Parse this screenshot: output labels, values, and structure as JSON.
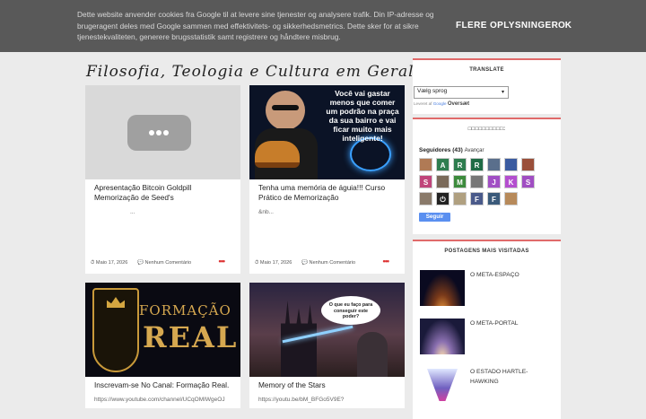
{
  "cookie": {
    "text": "Dette website anvender cookies fra Google til at levere sine tjenester og analysere trafik. Din IP-adresse og brugeragent deles med Google sammen med effektivitets- og sikkerhedsmetrics. Dette sker for at sikre tjenestekvaliteten, generere brugsstatistik samt registrere og håndtere misbrug.",
    "more_label": "FLERE OPLYSNINGER",
    "ok_label": "OK"
  },
  "blog": {
    "title": "Filosofia, Teologia e Cultura em Geral!"
  },
  "posts": [
    {
      "title": "Apresentação Bitcoin Goldpill Memorização de Seed's",
      "excerpt": "...",
      "date": "Maio 17, 2026",
      "comments": "Nenhum Comentário"
    },
    {
      "title": "Tenha uma memória de águia!!! Curso Prático de Memorização",
      "excerpt": "&nb...",
      "date": "Maio 17, 2026",
      "comments": "Nenhum Comentário",
      "thumb_text": "Você vai gastar menos que comer um podrão na praça da sua bairro e vai ficar muito mais inteligente!"
    },
    {
      "title": "Inscrevam-se No Canal: Formação Real.",
      "excerpt": "https://www.youtube.com/channel/UCqOMIWgeOJ",
      "thumb_line1": "FORMAÇÃO",
      "thumb_line2": "REAL"
    },
    {
      "title": "Memory of the Stars",
      "excerpt": "https://youtu.be/bM_BFGo5V9E?",
      "thumb_bubble": "O que eu faço para conseguir este poder?"
    }
  ],
  "more_dots": "•••",
  "sidebar": {
    "translate": {
      "title": "TRANSLATE",
      "select_value": "Vælg sprog",
      "powered_prefix": "Leveret af",
      "powered_google": "Google",
      "powered_suffix": "Oversæt"
    },
    "followers": {
      "title": "□□□□□□□□□□:",
      "label": "Seguidores (43)",
      "advance": "Avançar",
      "follow_label": "Seguir",
      "avatars": [
        {
          "letter": "",
          "color": "#b07a55"
        },
        {
          "letter": "A",
          "color": "#2e7d4f"
        },
        {
          "letter": "R",
          "color": "#2e7d4f"
        },
        {
          "letter": "R",
          "color": "#1f6b45"
        },
        {
          "letter": "",
          "color": "#5a6f8c"
        },
        {
          "letter": "",
          "color": "#3b5ba0"
        },
        {
          "letter": "",
          "color": "#9a4f3a"
        },
        {
          "letter": "S",
          "color": "#c0457b"
        },
        {
          "letter": "",
          "color": "#7a6a5a"
        },
        {
          "letter": "M",
          "color": "#3d8b3d"
        },
        {
          "letter": "",
          "color": "#777777"
        },
        {
          "letter": "J",
          "color": "#a14fc4"
        },
        {
          "letter": "K",
          "color": "#b44fcf"
        },
        {
          "letter": "S",
          "color": "#a04ec2"
        },
        {
          "letter": "",
          "color": "#8a7a6a"
        },
        {
          "letter": "⏻",
          "color": "#222222"
        },
        {
          "letter": "",
          "color": "#b0a080"
        },
        {
          "letter": "F",
          "color": "#4a5a8a"
        },
        {
          "letter": "F",
          "color": "#3a5a7a"
        },
        {
          "letter": "",
          "color": "#b78a5a"
        }
      ]
    },
    "popular": {
      "title": "POSTAGENS MAIS VISITADAS",
      "items": [
        {
          "title": "O META-ESPAÇO"
        },
        {
          "title": "O META-PORTAL"
        },
        {
          "title": "O ESTADO HARTLE-HAWKING"
        }
      ]
    }
  },
  "colors": {
    "accent": "#e06a6a",
    "cookie_bg": "#595959",
    "page_bg": "#ebebeb",
    "follow_button": "#5a8ff0"
  }
}
